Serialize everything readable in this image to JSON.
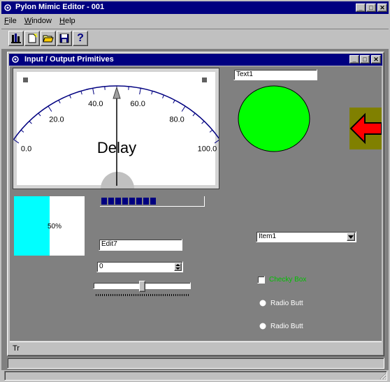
{
  "app": {
    "title": "Pylon Mimic Editor - 001"
  },
  "menu": [
    {
      "underline": "F",
      "rest": "ile"
    },
    {
      "underline": "W",
      "rest": "indow"
    },
    {
      "underline": "H",
      "rest": "elp"
    }
  ],
  "toolbar": [
    "build-icon",
    "new-icon",
    "open-folder-icon",
    "save-icon",
    "help-icon"
  ],
  "toolbar_help_glyph": "?",
  "child": {
    "title": "Input / Output Primitives"
  },
  "window_buttons": {
    "minimize": "_",
    "maximize": "□",
    "close": "✕"
  },
  "gauge": {
    "ticks": [
      "0.0",
      "20.0",
      "40.0",
      "60.0",
      "80.0",
      "100.0"
    ],
    "caption": "Delay",
    "value": 50,
    "min": 0,
    "max": 100
  },
  "progress": {
    "label": "50%",
    "value": 0.5
  },
  "segmented_bar": {
    "filled": 8,
    "total": 21
  },
  "text_field": {
    "value": "Text1"
  },
  "edit_field": {
    "value": "Edit7"
  },
  "spin_field": {
    "value": "0"
  },
  "slider": {
    "value": 0.5
  },
  "dropdown": {
    "value": "Item1"
  },
  "checkbox": {
    "label": "Checky Box",
    "checked": false,
    "label_color": "#00c000"
  },
  "radios": [
    {
      "label": "Radio Butt"
    },
    {
      "label": "Radio Butt"
    }
  ],
  "status": {
    "text": "Tr"
  },
  "colors": {
    "titlebar": "#000080",
    "workspace": "#808080",
    "lamp": "#00ff00",
    "arrow_bg": "#808000",
    "arrow": "#ff0000",
    "progress_fill": "#00ffff",
    "segments": "#000080"
  }
}
